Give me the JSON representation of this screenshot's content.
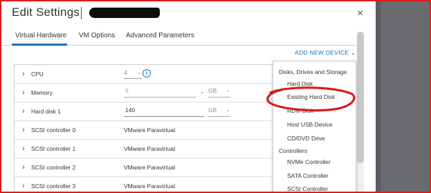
{
  "dialog": {
    "title": "Edit Settings",
    "close_label": "×"
  },
  "tabs": [
    {
      "label": "Virtual Hardware",
      "active": true
    },
    {
      "label": "VM Options",
      "active": false
    },
    {
      "label": "Advanced Parameters",
      "active": false
    }
  ],
  "add_device": {
    "label": "ADD NEW DEVICE",
    "caret": "⌄"
  },
  "hardware": {
    "expand_glyph": "›",
    "cpu": {
      "label": "CPU",
      "value": "4",
      "caret": "⌄",
      "info_glyph": "i"
    },
    "memory": {
      "label": "Memory",
      "value": "8",
      "caret": "⌄",
      "unit": "GB"
    },
    "hard_disk": {
      "label": "Hard disk 1",
      "value": "140",
      "unit": "GB"
    },
    "scsi": [
      {
        "label": "SCSI controller 0",
        "value": "VMware Paravirtual"
      },
      {
        "label": "SCSI controller 1",
        "value": "VMware Paravirtual"
      },
      {
        "label": "SCSI controller 2",
        "value": "VMware Paravirtual"
      },
      {
        "label": "SCSI controller 3",
        "value": "VMware Paravirtual"
      }
    ]
  },
  "dropdown": {
    "section_storage": "Disks, Drives and Storage",
    "storage_items": [
      "Hard Disk",
      "Existing Hard Disk",
      "RDM Disk",
      "Host USB Device",
      "CD/DVD Drive"
    ],
    "section_controllers": "Controllers",
    "controller_items": [
      "NVMe Controller",
      "SATA Controller",
      "SCSI Controller"
    ]
  },
  "icons": {
    "close": "close-icon",
    "info": "info-icon",
    "chevron": "chevron-right-icon",
    "caret": "chevron-down-icon"
  },
  "colors": {
    "accent": "#1a70b8",
    "annotation": "#d81b1b",
    "redaction": "#0d0d0d"
  }
}
